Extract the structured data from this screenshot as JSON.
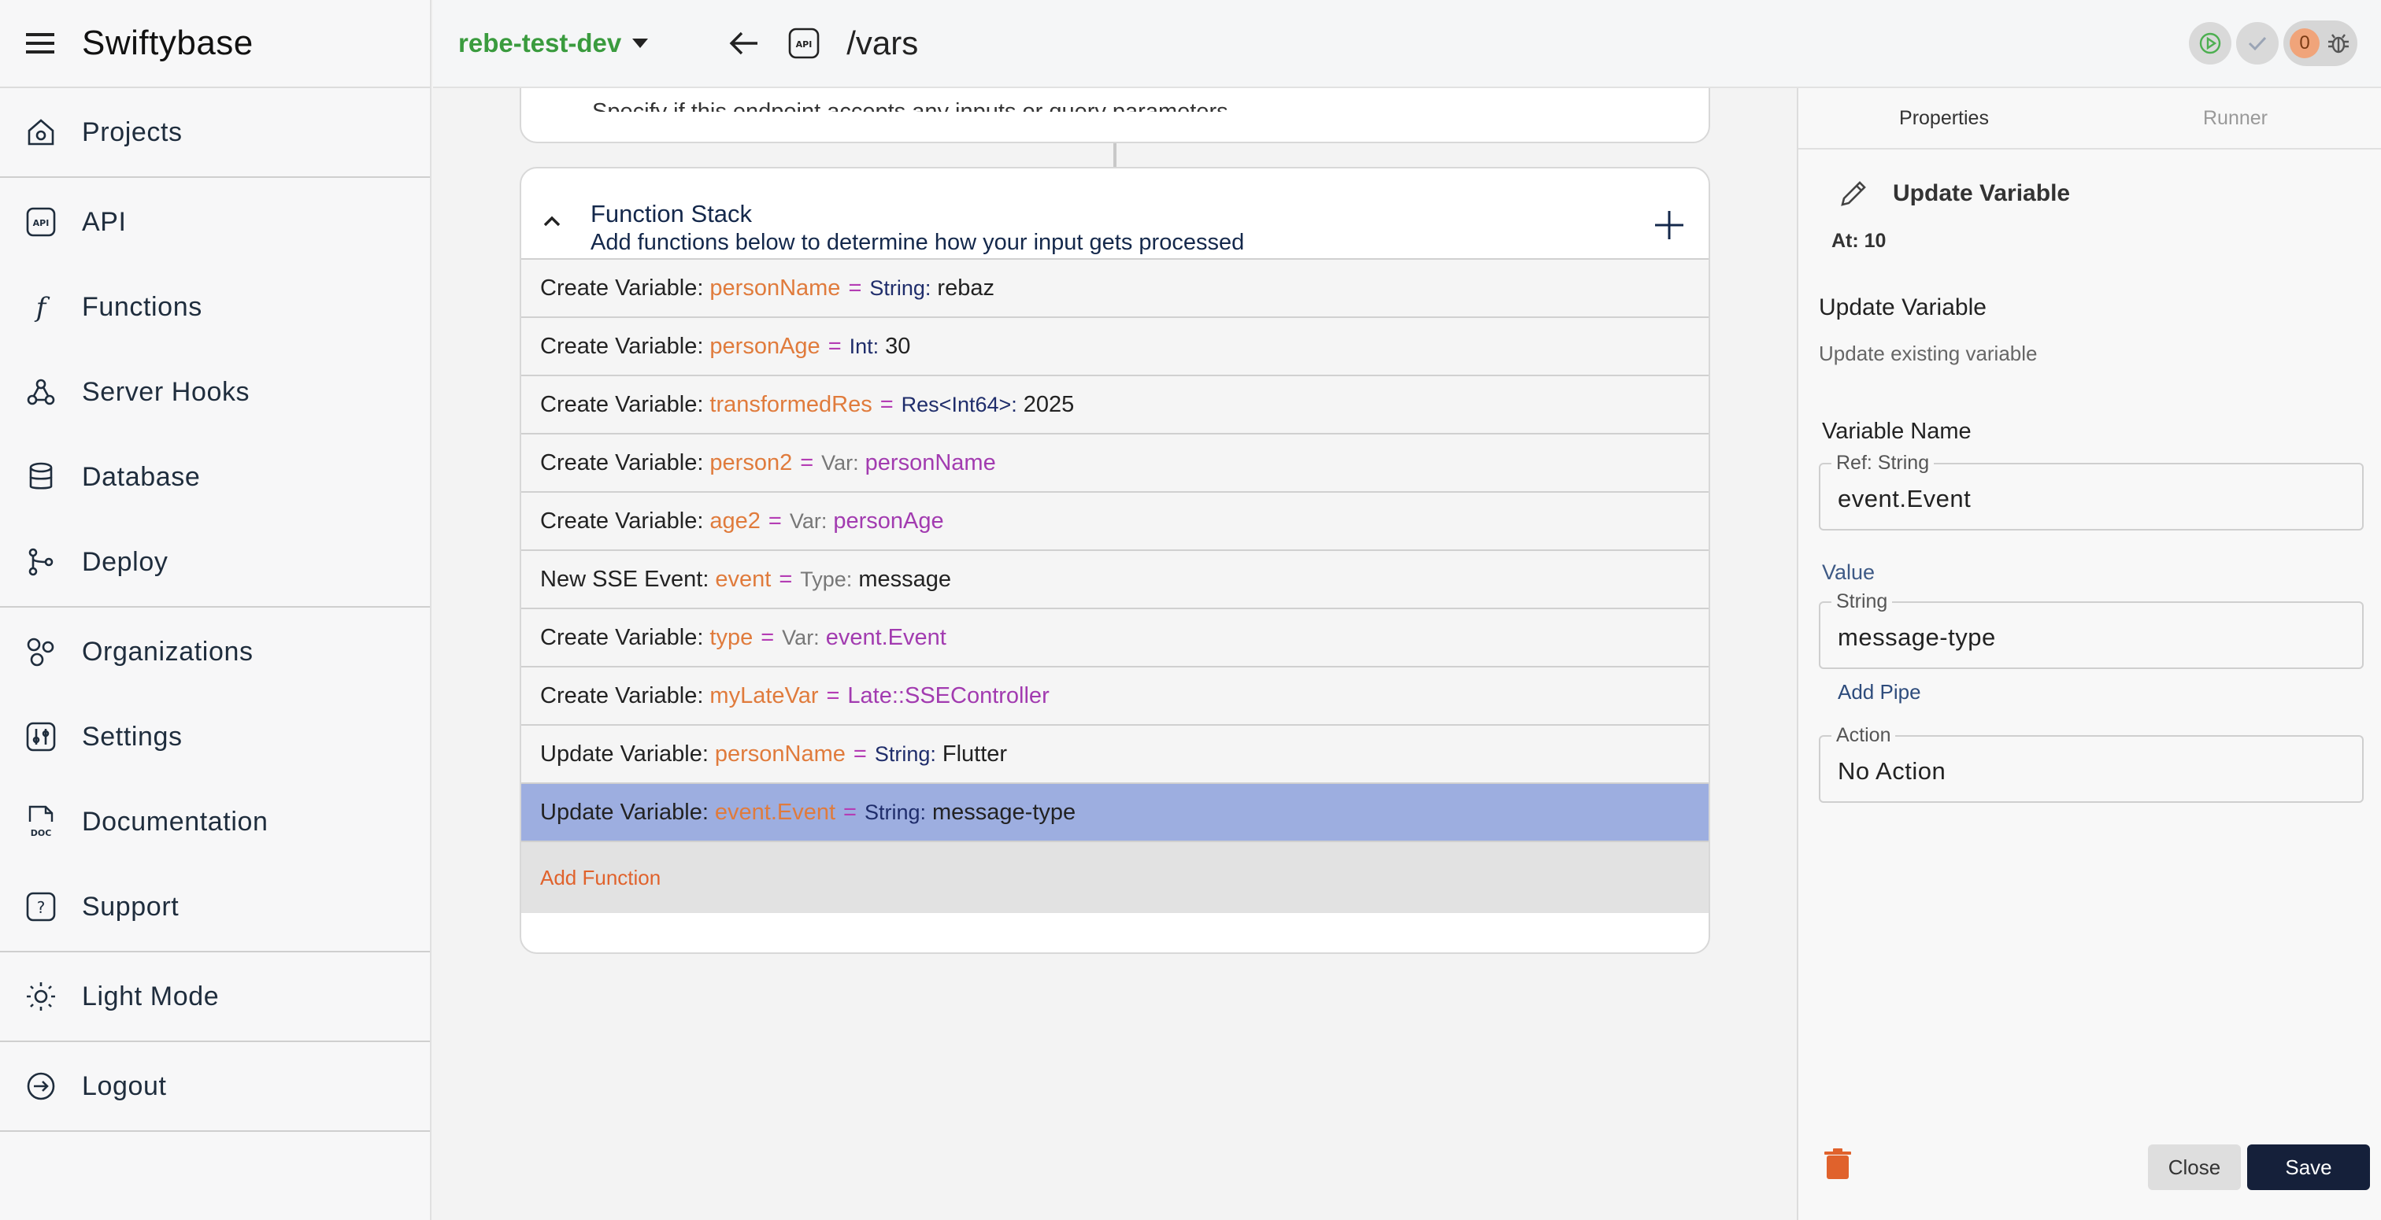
{
  "app": {
    "name": "Swiftybase",
    "menu_icon": "hamburger-icon"
  },
  "sidebar": {
    "groups": [
      [
        {
          "label": "Projects",
          "icon": "home-icon"
        }
      ],
      [
        {
          "label": "API",
          "icon": "api-icon"
        },
        {
          "label": "Functions",
          "icon": "function-icon"
        },
        {
          "label": "Server Hooks",
          "icon": "webhook-icon"
        },
        {
          "label": "Database",
          "icon": "database-icon"
        },
        {
          "label": "Deploy",
          "icon": "branch-icon"
        }
      ],
      [
        {
          "label": "Organizations",
          "icon": "organizations-icon"
        },
        {
          "label": "Settings",
          "icon": "settings-icon"
        },
        {
          "label": "Documentation",
          "icon": "doc-icon"
        },
        {
          "label": "Support",
          "icon": "question-icon"
        }
      ],
      [
        {
          "label": "Light Mode",
          "icon": "sun-icon"
        }
      ],
      [
        {
          "label": "Logout",
          "icon": "logout-icon"
        }
      ]
    ]
  },
  "topbar": {
    "project": "rebe-test-dev",
    "api_badge": "API",
    "route": "/vars",
    "error_count": "0"
  },
  "main": {
    "inputs_desc": "Specify if this endpoint accepts any inputs or query parameters",
    "stack_title": "Function Stack",
    "stack_sub": "Add functions below to determine how your input gets processed",
    "rows": [
      {
        "prefix": "Create Variable:",
        "var": "personName",
        "eq": "=",
        "type": "String:",
        "value": "rebaz"
      },
      {
        "prefix": "Create Variable:",
        "var": "personAge",
        "eq": "=",
        "type": "Int:",
        "value": "30"
      },
      {
        "prefix": "Create Variable:",
        "var": "transformedRes",
        "eq": "=",
        "type": "Res<Int64>:",
        "value": "2025"
      },
      {
        "prefix": "Create Variable:",
        "var": "person2",
        "eq": "=",
        "type": "Var:",
        "value": "personName"
      },
      {
        "prefix": "Create Variable:",
        "var": "age2",
        "eq": "=",
        "type": "Var:",
        "value": "personAge"
      },
      {
        "prefix": "New SSE Event:",
        "var": "event",
        "eq": "=",
        "type": "Type:",
        "value": "message"
      },
      {
        "prefix": "Create Variable:",
        "var": "type",
        "eq": "=",
        "type": "Var:",
        "value": "event.Event"
      },
      {
        "prefix": "Create Variable:",
        "var": "myLateVar",
        "eq": "=",
        "type": "",
        "value": "Late::SSEController"
      },
      {
        "prefix": "Update Variable:",
        "var": "personName",
        "eq": "=",
        "type": "String:",
        "value": "Flutter"
      },
      {
        "prefix": "Update Variable:",
        "var": "event.Event",
        "eq": "=",
        "type": "String:",
        "value": "message-type"
      }
    ],
    "add_function": "Add Function"
  },
  "panel": {
    "tabs": [
      "Properties",
      "Runner"
    ],
    "header": "Update Variable",
    "at": "At: 10",
    "title": "Update Variable",
    "desc": "Update existing variable",
    "var_name_label": "Variable Name",
    "var_name_legend": "Ref: String",
    "var_name_value": "event.Event",
    "value_label": "Value",
    "value_legend": "String",
    "value_value": "message-type",
    "add_pipe": "Add Pipe",
    "action_legend": "Action",
    "action_value": "No Action",
    "close": "Close",
    "save": "Save"
  },
  "colors": {
    "brand_green": "#3a9b3e",
    "var_orange": "#e07b3c",
    "selected_row": "#9daee0",
    "save_button": "#15203a",
    "add_function": "#e0622c"
  }
}
